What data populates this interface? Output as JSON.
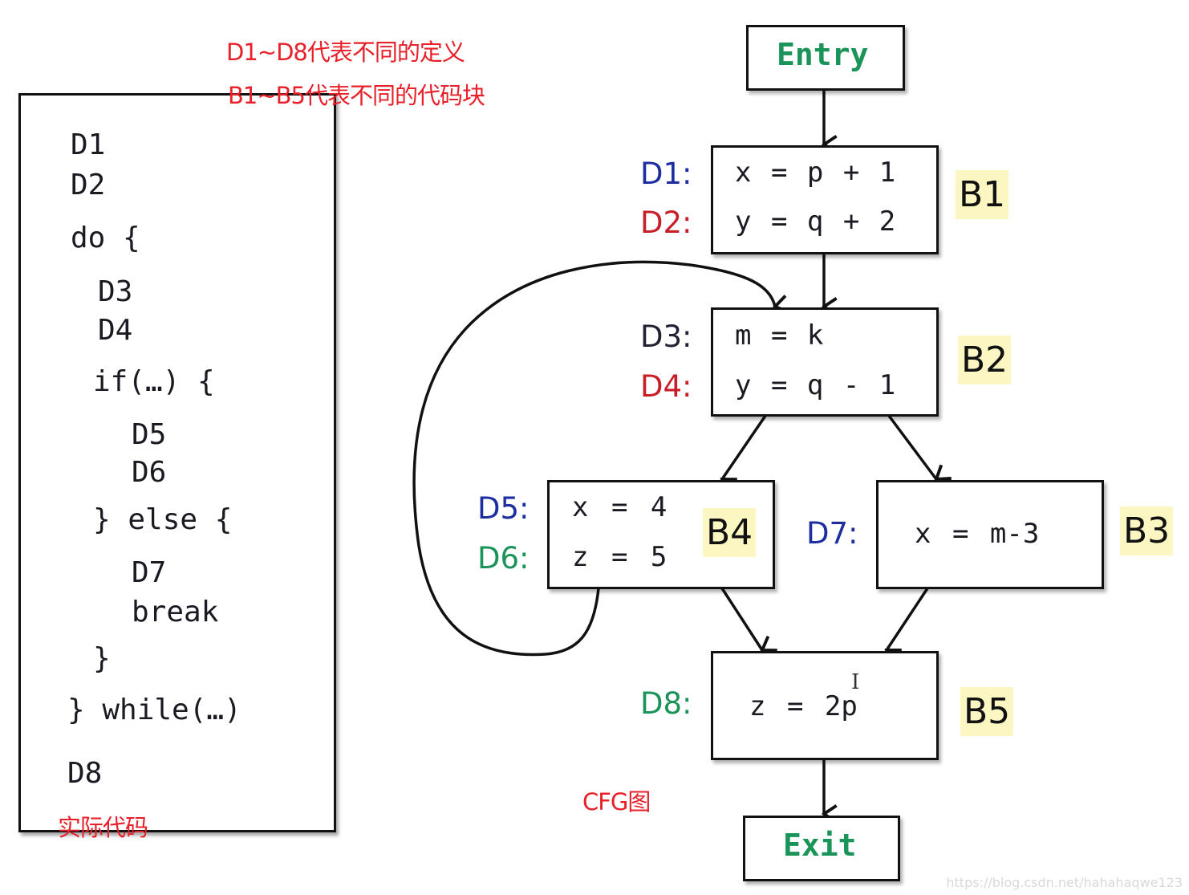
{
  "annotations": {
    "defs_note": "D1~D8代表不同的定义",
    "blocks_note": "B1~B5代表不同的代码块",
    "code_caption": "实际代码",
    "cfg_caption": "CFG图"
  },
  "code": {
    "lines": [
      "D1",
      "D2",
      "do {",
      "D3",
      "D4",
      "if(…) {",
      "D5",
      "D6",
      "} else {",
      "D7",
      "break",
      "}",
      "} while(…)",
      "D8"
    ]
  },
  "colors": {
    "blue": "#1c2ea0",
    "red": "#c81e28",
    "green": "#1a9458",
    "dark": "#222233",
    "highlight": "#fbf6c2",
    "annotation": "#e8202a"
  },
  "cfg": {
    "entry": "Entry",
    "exit": "Exit",
    "blocks": [
      {
        "id": "B1",
        "defs": [
          {
            "label": "D1:",
            "color": "blue",
            "stmt": "x = p + 1"
          },
          {
            "label": "D2:",
            "color": "red",
            "stmt": "y = q + 2"
          }
        ]
      },
      {
        "id": "B2",
        "defs": [
          {
            "label": "D3:",
            "color": "dark",
            "stmt": "m = k"
          },
          {
            "label": "D4:",
            "color": "red",
            "stmt": "y = q - 1"
          }
        ]
      },
      {
        "id": "B4",
        "defs": [
          {
            "label": "D5:",
            "color": "blue",
            "stmt": "x = 4"
          },
          {
            "label": "D6:",
            "color": "green",
            "stmt": "z = 5"
          }
        ]
      },
      {
        "id": "B3",
        "defs": [
          {
            "label": "D7:",
            "color": "blue",
            "stmt": "x = m-3"
          }
        ]
      },
      {
        "id": "B5",
        "defs": [
          {
            "label": "D8:",
            "color": "green",
            "stmt": "z = 2p"
          }
        ]
      }
    ],
    "edges": [
      [
        "Entry",
        "B1"
      ],
      [
        "B1",
        "B2"
      ],
      [
        "B2",
        "B4"
      ],
      [
        "B2",
        "B3"
      ],
      [
        "B4",
        "B5"
      ],
      [
        "B3",
        "B5"
      ],
      [
        "B4",
        "B2"
      ],
      [
        "B5",
        "Exit"
      ]
    ]
  },
  "watermark": "https://blog.csdn.net/hahahaqwe123"
}
